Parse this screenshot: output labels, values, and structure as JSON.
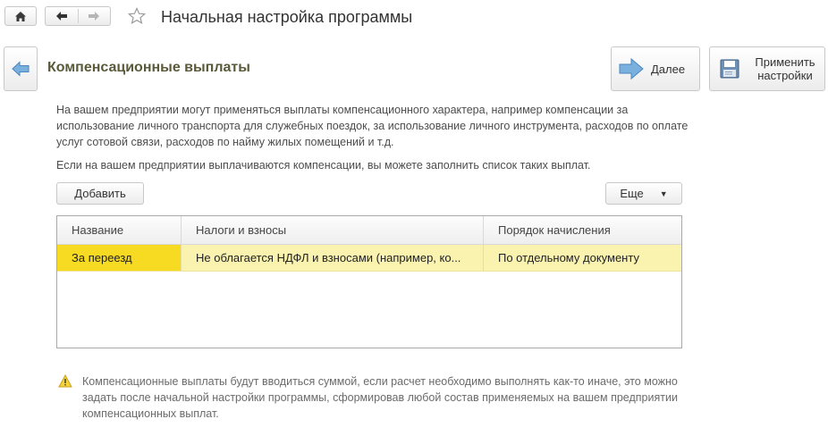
{
  "titlebar": {
    "home_icon": "home-icon",
    "back_icon": "arrow-left-icon",
    "forward_icon": "arrow-right-icon",
    "favorite_icon": "star-icon",
    "title": "Начальная настройка программы"
  },
  "header": {
    "section_title": "Компенсационные выплаты",
    "next_label": "Далее",
    "apply_label_1": "Применить",
    "apply_label_2": "настройки"
  },
  "description": {
    "line1": "На вашем предприятии могут применяться выплаты компенсационного характера, например компенсации за",
    "line2": "использование личного транспорта для служебных поездок, за использование личного инструмента, расходов по оплате",
    "line3": "услуг сотовой связи, расходов по найму жилых помещений и т.д.",
    "line4": "Если на вашем предприятии выплачиваются компенсации, вы можете заполнить список таких выплат."
  },
  "toolbar": {
    "add_label": "Добавить",
    "more_label": "Еще"
  },
  "table": {
    "columns": [
      "Название",
      "Налоги и взносы",
      "Порядок начисления"
    ],
    "rows": [
      [
        "За переезд",
        "Не облагается НДФЛ и взносами (например, ко...",
        "По отдельному документу"
      ]
    ]
  },
  "note": {
    "line1": "Компенсационные выплаты будут вводиться суммой, если расчет необходимо выполнять как-то иначе, это можно",
    "line2": "задать после начальной настройки программы, сформировав любой состав применяемых на вашем предприятии",
    "line3": "компенсационных выплат."
  },
  "colors": {
    "selected_row": "#faf3b0",
    "selected_cell": "#f7da22",
    "arrow_blue": "#5b9bd5"
  }
}
